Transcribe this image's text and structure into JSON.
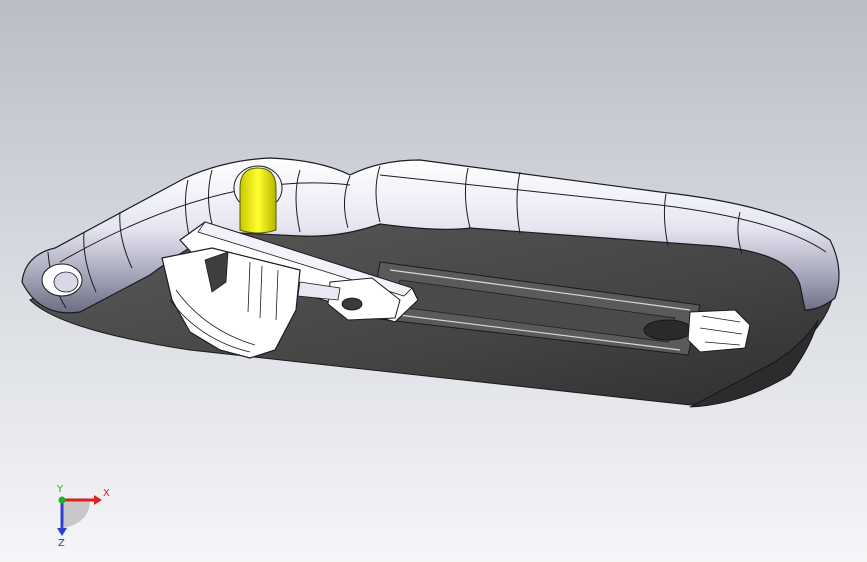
{
  "viewport": {
    "background_top": "#b9bec6",
    "background_bottom": "#f5f6f8"
  },
  "model": {
    "frame_color": "#e4e4f0",
    "plate_color": "#3f3f3f",
    "highlight_color": "#f2f200",
    "clip_color": "#ffffff"
  },
  "triad": {
    "x_label": "X",
    "y_label": "Y",
    "z_label": "Z",
    "x_color": "#e0201e",
    "y_color": "#20b020",
    "z_color": "#2a3fcf"
  }
}
